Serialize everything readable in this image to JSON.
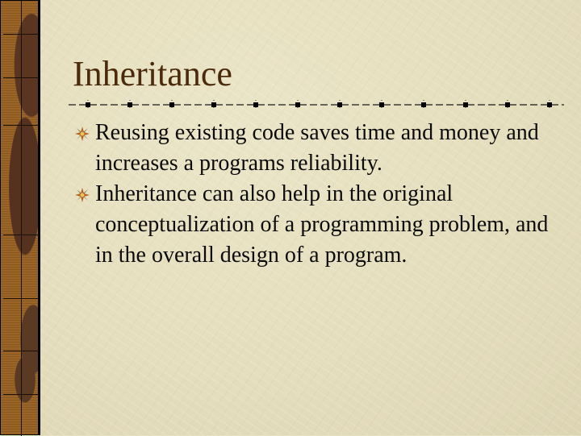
{
  "slide": {
    "title": "Inheritance",
    "bullets": [
      {
        "icon": "compass-star-bullet-icon",
        "text": "Reusing existing code saves time and money and increases a programs reliability."
      },
      {
        "icon": "compass-star-bullet-icon",
        "text": "Inheritance can also help in the original conceptualization of a programming problem, and in the overall design of a program."
      }
    ]
  },
  "theme": {
    "background": "#e7e0c1",
    "title_color": "#4a2a0a",
    "text_color": "#0b0b0b",
    "strip_color": "#9a6526",
    "bullet_colors": [
      "#b5651d",
      "#f0c060",
      "#5a3a22"
    ]
  }
}
